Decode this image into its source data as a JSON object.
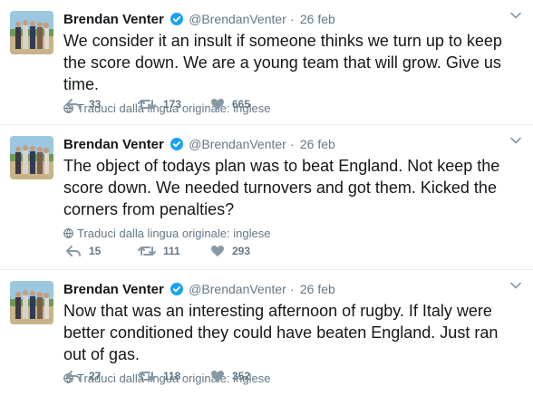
{
  "tweets": [
    {
      "name": "Brendan Venter",
      "handle": "@BrendanVenter",
      "separator": "·",
      "date": "26 feb",
      "text": "We consider it an insult if someone thinks we turn up to keep the score down. We are a young team that will grow. Give us time.",
      "translate": "Traduci dalla lingua originale: inglese",
      "replies": "33",
      "retweets": "173",
      "likes": "665"
    },
    {
      "name": "Brendan Venter",
      "handle": "@BrendanVenter",
      "separator": "·",
      "date": "26 feb",
      "text": "The object of todays plan was to beat England. Not keep the score down. We needed turnovers and got them. Kicked the corners from penalties?",
      "translate": "Traduci dalla lingua originale: inglese",
      "replies": "15",
      "retweets": "111",
      "likes": "293"
    },
    {
      "name": "Brendan Venter",
      "handle": "@BrendanVenter",
      "separator": "·",
      "date": "26 feb",
      "text": "Now that was an interesting afternoon of rugby. If Italy were better conditioned they could have beaten England. Just ran out of gas.",
      "translate": "Traduci dalla lingua originale: inglese",
      "replies": "27",
      "retweets": "118",
      "likes": "352"
    }
  ],
  "icons": {
    "verified": "verified-badge-icon",
    "globe": "globe-icon",
    "reply": "reply-icon",
    "retweet": "retweet-icon",
    "like": "heart-icon",
    "caret": "chevron-down-icon"
  },
  "colors": {
    "verified": "#1da1f2",
    "muted": "#657786",
    "text": "#14171a",
    "divider": "#e6ecf0"
  }
}
